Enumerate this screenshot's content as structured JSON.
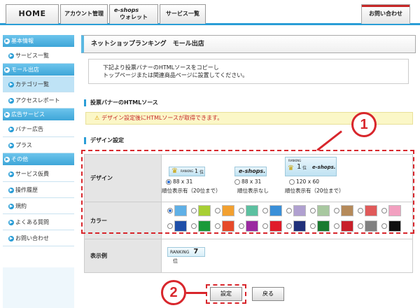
{
  "nav": {
    "home": "HOME",
    "account": "アカウント管理",
    "wallet_line1": "e-shops",
    "wallet_line2": "ウォレット",
    "service_list": "サービス一覧",
    "contact": "お問い合わせ"
  },
  "sidebar": {
    "sections": [
      {
        "title": "基本情報",
        "items": [
          "サービス一覧"
        ]
      },
      {
        "title": "モール出店",
        "items": [
          "カテゴリ一覧",
          "アクセスレポート"
        ]
      },
      {
        "title": "広告サービス",
        "items": [
          "バナー広告",
          "プラス"
        ]
      },
      {
        "title": "その他",
        "items": [
          "サービス仮費",
          "操作履歴",
          "規約",
          "よくある質問",
          "お問い合わせ"
        ]
      }
    ]
  },
  "main": {
    "title": "ネットショップランキング　モール出店",
    "intro_line1": "下記より投票バナーのHTMLソースをコピーし",
    "intro_line2": "トップページまたは関連商品ページに設置してください。",
    "html_source_title": "投票バナーのHTMLソース",
    "notice": "デザイン設定後にHTMLソースが取得できます。",
    "design_title": "デザイン設定",
    "design_label": "デザイン",
    "design_options": [
      {
        "size": "88 x 31",
        "desc": "順位表示有（20位まで）",
        "banner_text": "RANKING",
        "rank": "1",
        "rank_unit": "位"
      },
      {
        "size": "88 x 31",
        "desc": "順位表示なし",
        "banner_text": "e-shops."
      },
      {
        "size": "120 x 60",
        "desc": "順位表示有（20位まで）",
        "banner_text": "RANKING",
        "rank": "1",
        "rank_unit": "位",
        "brand": "e-shops."
      }
    ],
    "color_label": "カラー",
    "colors_row1": [
      "#5fb0e6",
      "#a7cf34",
      "#f2a030",
      "#5cc0a0",
      "#3a8fd8",
      "#b0a0d0",
      "#a8c8a0",
      "#b58a5a",
      "#e05a5a",
      "#f2a0c0"
    ],
    "colors_row2": [
      "#1f4fa8",
      "#1a9a3a",
      "#e64a2a",
      "#9a2aa0",
      "#e01c2a",
      "#20307a",
      "#1a7a30",
      "#c8202a",
      "#808080",
      "#101010"
    ],
    "preview_label": "表示例",
    "preview_banner": "RANKING",
    "preview_rank": "7",
    "preview_unit": "位"
  },
  "buttons": {
    "submit": "設定",
    "back": "戻る"
  },
  "annotations": {
    "badge1": "1",
    "badge2": "2"
  }
}
